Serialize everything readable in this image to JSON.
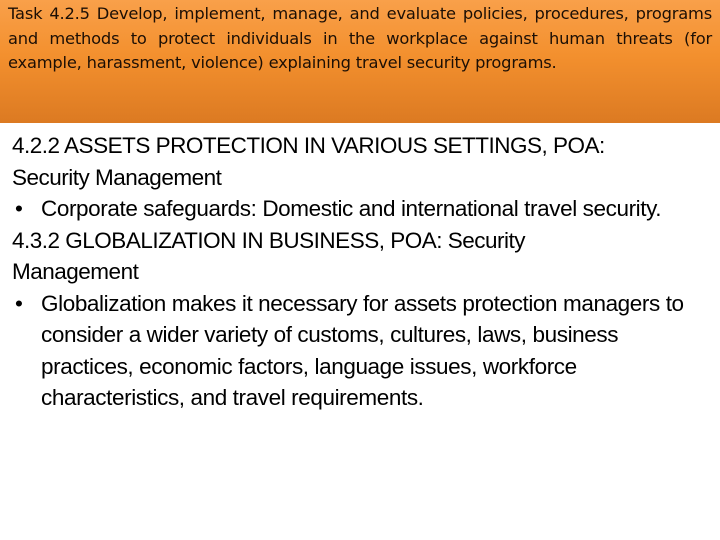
{
  "header": {
    "task_text": "Task 4.2.5 Develop, implement, manage, and evaluate policies, procedures, programs and methods to protect individuals in the workplace against human threats (for example, harassment, violence) explaining travel security programs.",
    "background_top": "#f9a04a",
    "background_bottom": "#dc7a22"
  },
  "sections": [
    {
      "heading_line1": "4.2.2 ASSETS PROTECTION IN VARIOUS SETTINGS, POA:",
      "heading_line2": "Security Management",
      "bullet": "Corporate safeguards: Domestic and international travel security."
    },
    {
      "heading_line1": "4.3.2 GLOBALIZATION IN BUSINESS, POA: Security",
      "heading_line2": "Management",
      "bullet": "Globalization makes it necessary for assets protection managers to consider a wider variety of customs, cultures, laws, business practices, economic factors, language issues, workforce characteristics, and travel requirements."
    }
  ],
  "bullet_glyph": "•"
}
